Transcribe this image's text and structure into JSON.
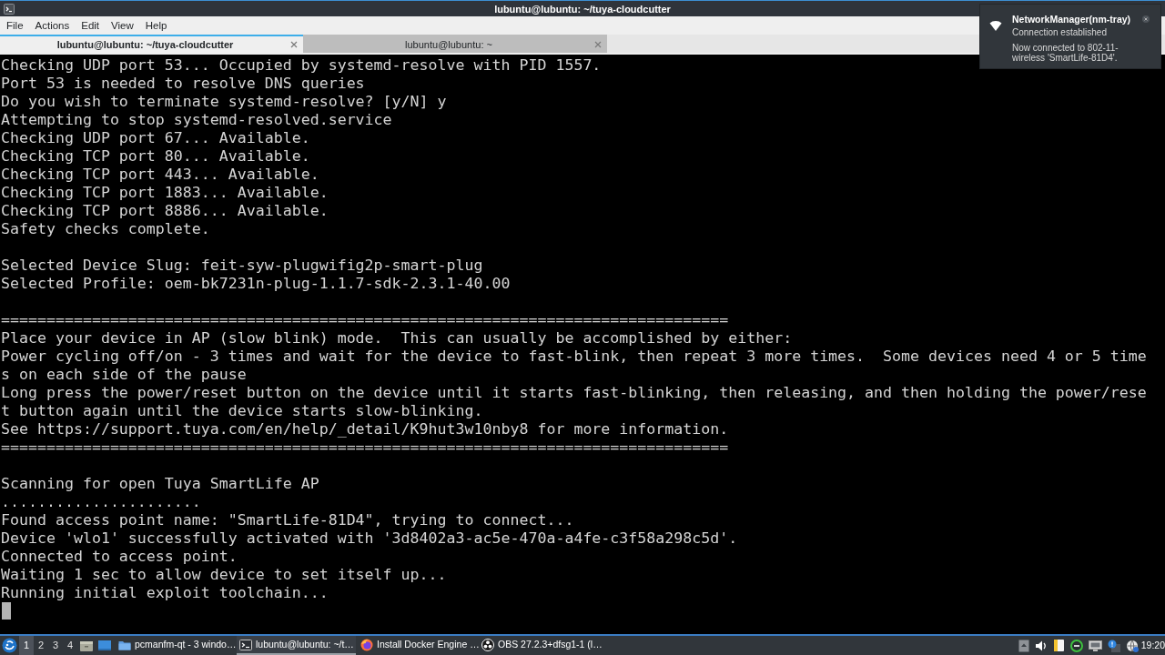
{
  "window": {
    "title": "lubuntu@lubuntu: ~/tuya-cloudcutter"
  },
  "menu": [
    "File",
    "Actions",
    "Edit",
    "View",
    "Help"
  ],
  "tabs": [
    {
      "label": "lubuntu@lubuntu: ~/tuya-cloudcutter",
      "selected": true
    },
    {
      "label": "lubuntu@lubuntu: ~",
      "selected": false
    }
  ],
  "terminal": {
    "blocks": [
      {
        "lines": [
          "Checking UDP port 53... Occupied by systemd-resolve with PID 1557.",
          "Port 53 is needed to resolve DNS queries",
          "Do you wish to terminate systemd-resolve? [y/N] y",
          "Attempting to stop systemd-resolved.service",
          "Checking UDP port 67... Available.",
          "Checking TCP port 80... Available.",
          "Checking TCP port 443... Available.",
          "Checking TCP port 1883... Available.",
          "Checking TCP port 8886... Available.",
          "Safety checks complete."
        ]
      },
      {
        "lines": [
          "Selected Device Slug: feit-syw-plugwifig2p-smart-plug",
          "Selected Profile: oem-bk7231n-plug-1.1.7-sdk-2.3.1-40.00"
        ]
      },
      {
        "lines": [
          "================================================================================",
          "Place your device in AP (slow blink) mode.  This can usually be accomplished by either:",
          "Power cycling off/on - 3 times and wait for the device to fast-blink, then repeat 3 more times.  Some devices need 4 or 5 time",
          "s on each side of the pause",
          "Long press the power/reset button on the device until it starts fast-blinking, then releasing, and then holding the power/rese",
          "t button again until the device starts slow-blinking.",
          "See https://support.tuya.com/en/help/_detail/K9hut3w10nby8 for more information.",
          "================================================================================"
        ]
      },
      {
        "lines": [
          "Scanning for open Tuya SmartLife AP",
          "......................",
          "Found access point name: \"SmartLife-81D4\", trying to connect...",
          "Device 'wlo1' successfully activated with '3d8402a3-ac5e-470a-a4fe-c3f58a298c5d'.",
          "Connected to access point.",
          "Waiting 1 sec to allow device to set itself up...",
          "Running initial exploit toolchain..."
        ]
      }
    ]
  },
  "taskbar": {
    "workspaces": [
      {
        "label": "1",
        "selected": true
      },
      {
        "label": "2",
        "selected": false
      },
      {
        "label": "3",
        "selected": false
      },
      {
        "label": "4",
        "selected": false
      }
    ],
    "tasks": [
      {
        "kind": "file-manager",
        "label": "pcmanfm-qt - 3 windo…",
        "selected": false
      },
      {
        "kind": "terminal",
        "label": "lubuntu@lubuntu: ~/t…",
        "selected": true
      },
      {
        "kind": "browser",
        "label": "Install Docker Engine …",
        "selected": false
      },
      {
        "kind": "recorder",
        "label": "OBS 27.2.3+dfsg1-1 (l…",
        "selected": false
      }
    ],
    "clock": "19:20"
  },
  "notification": {
    "title": "NetworkManager(nm-tray)",
    "summary": "Connection established",
    "body_lines": [
      "Now connected to 802-11-",
      "wireless 'SmartLife-81D4'."
    ]
  }
}
